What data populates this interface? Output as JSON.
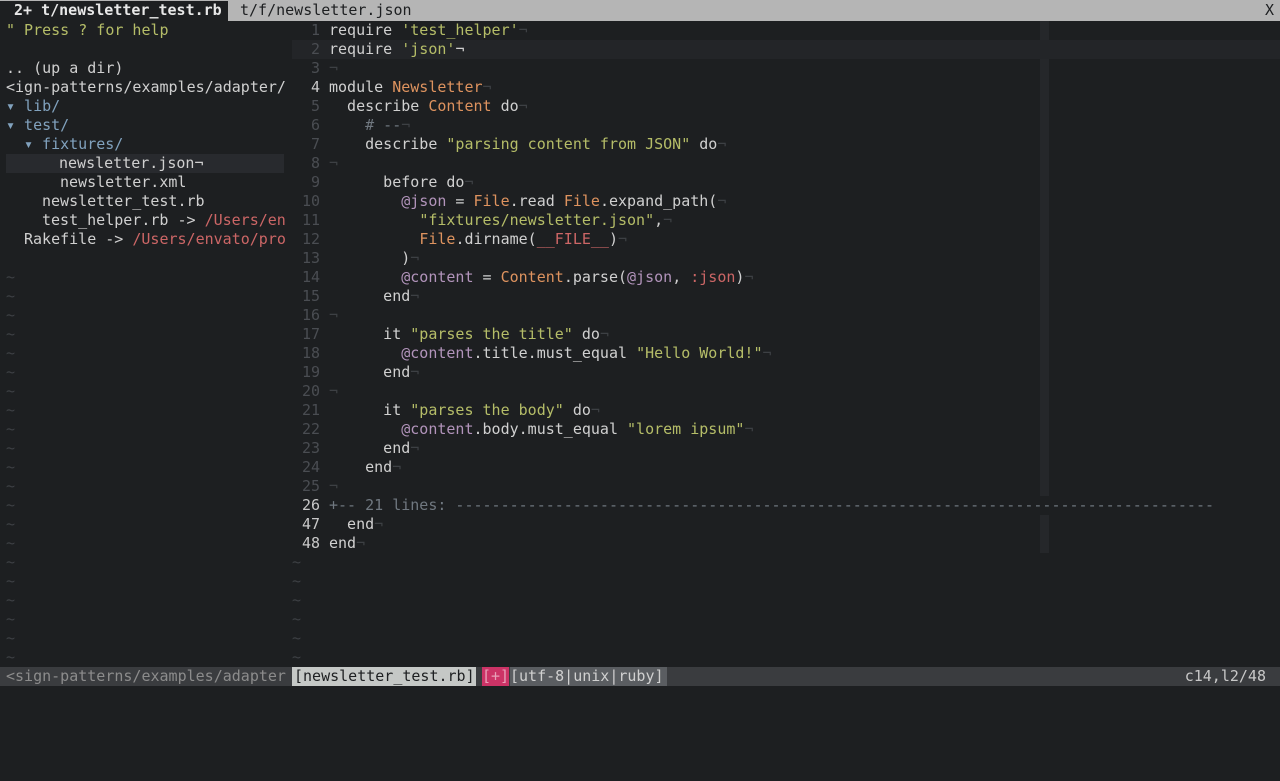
{
  "tabline": {
    "active_tab": "2+ t/newsletter_test.rb",
    "inactive_tab": "t/f/newsletter.json",
    "close": "X"
  },
  "tree": {
    "help": "\" Press ? for help",
    "up_dir": ".. (up a dir)",
    "root": "<ign-patterns/examples/adapter/",
    "items": [
      {
        "text": "▾ lib/",
        "kind": "dir",
        "indent": 0
      },
      {
        "text": "▾ test/",
        "kind": "dir",
        "indent": 0
      },
      {
        "text": "▾ fixtures/",
        "kind": "dir",
        "indent": 1
      },
      {
        "text": "newsletter.json¬",
        "kind": "file",
        "indent": 2,
        "selected": true
      },
      {
        "text": "newsletter.xml",
        "kind": "file",
        "indent": 2
      },
      {
        "text": "newsletter_test.rb",
        "kind": "file",
        "indent": 1
      },
      {
        "text": "test_helper.rb -> ",
        "link": "/Users/en",
        "kind": "file",
        "indent": 1
      },
      {
        "text": "Rakefile -> ",
        "link": "/Users/envato/pro",
        "kind": "file",
        "indent": 0
      }
    ]
  },
  "editor": {
    "lines": [
      {
        "n": "1",
        "html": "require <span class='str'>'test_helper'</span><span class='inv'>¬</span>"
      },
      {
        "n": "2",
        "html": "require <span class='str'>'json'</span>¬",
        "current": true
      },
      {
        "n": "3",
        "html": "<span class='inv'>¬</span>"
      },
      {
        "n": "4",
        "html": "module <span class='const'>Newsletter</span><span class='inv'>¬</span>"
      },
      {
        "n": "5",
        "html": "  describe <span class='const'>Content</span> do<span class='inv'>¬</span>"
      },
      {
        "n": "6",
        "html": "    <span class='cmt'># --</span><span class='inv'>¬</span>"
      },
      {
        "n": "7",
        "html": "    describe <span class='str'>\"parsing content from JSON\"</span> do<span class='inv'>¬</span>"
      },
      {
        "n": "8",
        "html": "<span class='inv'>¬</span>"
      },
      {
        "n": "9",
        "html": "      before do<span class='inv'>¬</span>"
      },
      {
        "n": "10",
        "html": "        <span class='ivar'>@json</span> = <span class='const'>File</span>.read <span class='const'>File</span>.expand_path(<span class='inv'>¬</span>"
      },
      {
        "n": "11",
        "html": "          <span class='str'>\"fixtures/newsletter.json\"</span>,<span class='inv'>¬</span>"
      },
      {
        "n": "12",
        "html": "          <span class='const'>File</span>.dirname(<span class='sym'>__FILE__</span>)<span class='inv'>¬</span>"
      },
      {
        "n": "13",
        "html": "        )<span class='inv'>¬</span>"
      },
      {
        "n": "14",
        "html": "        <span class='ivar'>@content</span> = <span class='const'>Content</span>.parse(<span class='ivar'>@json</span>, <span class='sym'>:json</span>)<span class='inv'>¬</span>"
      },
      {
        "n": "15",
        "html": "      end<span class='inv'>¬</span>"
      },
      {
        "n": "16",
        "html": "<span class='inv'>¬</span>"
      },
      {
        "n": "17",
        "html": "      it <span class='str'>\"parses the title\"</span> do<span class='inv'>¬</span>"
      },
      {
        "n": "18",
        "html": "        <span class='ivar'>@content</span>.title.must_equal <span class='str'>\"Hello World!\"</span><span class='inv'>¬</span>"
      },
      {
        "n": "19",
        "html": "      end<span class='inv'>¬</span>"
      },
      {
        "n": "20",
        "html": "<span class='inv'>¬</span>"
      },
      {
        "n": "21",
        "html": "      it <span class='str'>\"parses the body\"</span> do<span class='inv'>¬</span>"
      },
      {
        "n": "22",
        "html": "        <span class='ivar'>@content</span>.body.must_equal <span class='str'>\"lorem ipsum\"</span><span class='inv'>¬</span>"
      },
      {
        "n": "23",
        "html": "      end<span class='inv'>¬</span>"
      },
      {
        "n": "24",
        "html": "    end<span class='inv'>¬</span>"
      },
      {
        "n": "25",
        "html": "<span class='inv'>¬</span>"
      },
      {
        "n": "26",
        "html": "<span class='fold'>+-- 21 lines: ------------------------------------------------------------------------------------</span>",
        "current": true
      },
      {
        "n": "47",
        "html": "  end<span class='inv'>¬</span>"
      },
      {
        "n": "48",
        "html": "end<span class='inv'>¬</span>"
      }
    ]
  },
  "status": {
    "left": "<sign-patterns/examples/adapter",
    "file": "[newsletter_test.rb]",
    "modified": "[+]",
    "info": "[utf-8|unix|ruby]",
    "position": "c14,l2/48"
  },
  "colors": {
    "background": "#1d1f21",
    "string": "#b5bd68",
    "constant": "#de935f",
    "ivar": "#b294bb",
    "symbol": "#cc6666",
    "directory": "#81a2be",
    "modified_flag": "#cc3366"
  }
}
